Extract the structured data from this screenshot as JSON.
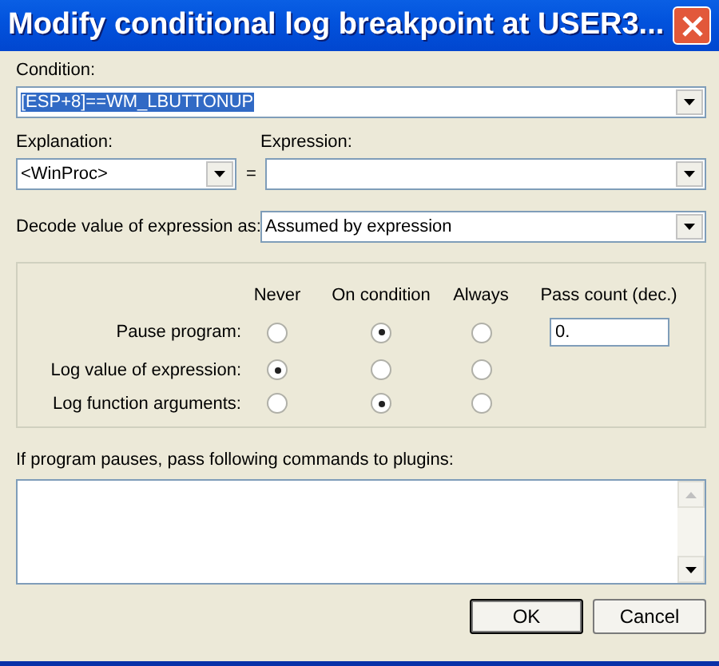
{
  "window": {
    "title": "Modify conditional log breakpoint at USER3..."
  },
  "condition": {
    "label": "Condition:",
    "value": "[ESP+8]==WM_LBUTTONUP"
  },
  "explanation": {
    "label": "Explanation:",
    "value": "<WinProc>"
  },
  "equals": "=",
  "expression": {
    "label": "Expression:"
  },
  "decode": {
    "label": "Decode value of expression as:",
    "value": "Assumed by expression"
  },
  "options": {
    "columns": [
      "Never",
      "On condition",
      "Always",
      "Pass count (dec.)"
    ],
    "rows": [
      {
        "label": "Pause program:",
        "choices": [
          {
            "selected": false
          },
          {
            "selected": true
          },
          {
            "selected": false
          }
        ],
        "pass_count": "0."
      },
      {
        "label": "Log value of expression:",
        "choices": [
          {
            "selected": true
          },
          {
            "selected": false
          },
          {
            "selected": false
          }
        ]
      },
      {
        "label": "Log function arguments:",
        "choices": [
          {
            "selected": false
          },
          {
            "selected": true
          },
          {
            "selected": false
          }
        ]
      }
    ]
  },
  "commands": {
    "label": "If program pauses, pass following commands to plugins:"
  },
  "buttons": [
    {
      "label": "OK",
      "default": true
    },
    {
      "label": "Cancel",
      "default": false
    }
  ]
}
